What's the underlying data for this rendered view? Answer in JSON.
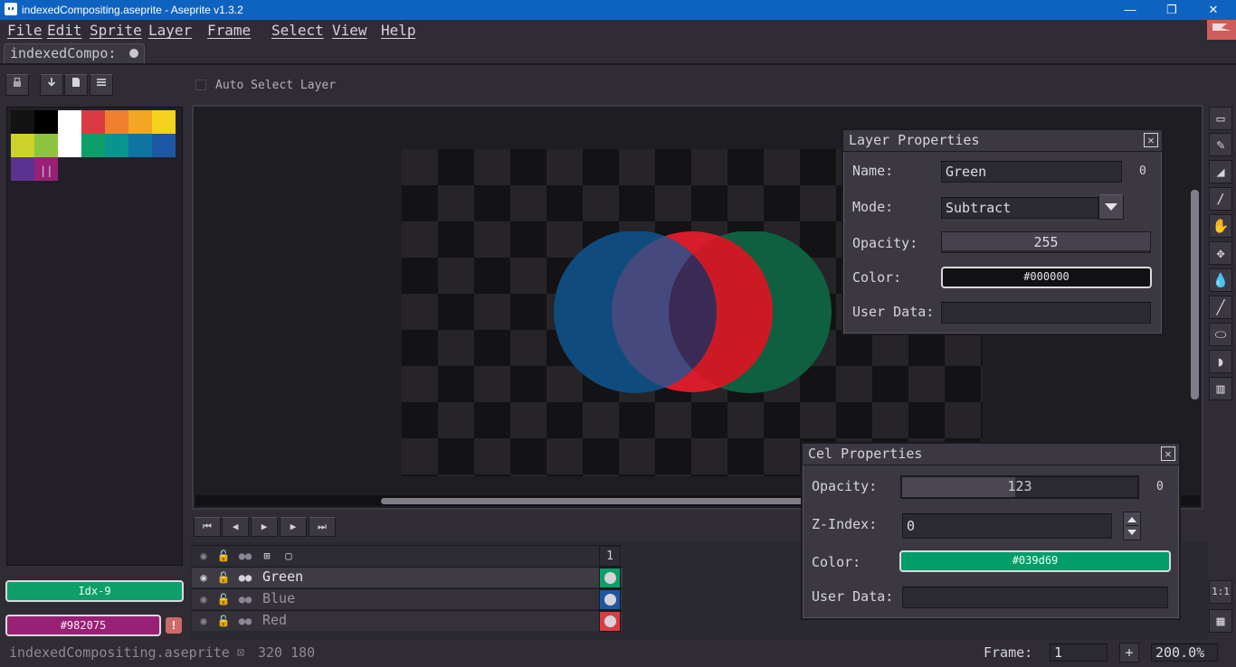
{
  "window": {
    "title": "indexedCompositing.aseprite - Aseprite v1.3.2",
    "minimize_icon": "—",
    "restore_icon": "❐",
    "close_icon": "✕"
  },
  "menu": [
    "File",
    "Edit",
    "Sprite",
    "Layer",
    "Frame",
    "Select",
    "View",
    "Help"
  ],
  "tab": {
    "label": "indexedCompo:"
  },
  "toolbar": {
    "auto_select_label": "Auto Select Layer"
  },
  "palette": {
    "colors": [
      "#121212",
      "#000000",
      "#ffffff",
      "#d93b42",
      "#f07f2f",
      "#f3a623",
      "#f5d21f",
      "#cbd229",
      "#8dc43f",
      "#ffffff",
      "#0d9e69",
      "#09958f",
      "#0f73a3",
      "#1d58a4",
      "#5c3290",
      "#982075"
    ],
    "extra_marker": "||"
  },
  "fg_color": {
    "label": "Idx-9",
    "hex": "#0d9e69"
  },
  "bg_color": {
    "label": "#982075",
    "hex": "#982075"
  },
  "warning_icon": "!",
  "playback": [
    "⏮",
    "◀",
    "▶",
    "▶",
    "⏭"
  ],
  "timeline": {
    "frame_number": "1",
    "layers": [
      {
        "name": "Green",
        "cel_color": "#0d9e69",
        "active": true
      },
      {
        "name": "Blue",
        "cel_color": "#1d58a4",
        "active": false
      },
      {
        "name": "Red",
        "cel_color": "#d93b42",
        "active": false
      }
    ]
  },
  "layer_props": {
    "title": "Layer Properties",
    "close": "✕",
    "name_label": "Name:",
    "name_value": "Green",
    "zero": "0",
    "mode_label": "Mode:",
    "mode_value": "Subtract",
    "opacity_label": "Opacity:",
    "opacity_value": "255",
    "color_label": "Color:",
    "color_value": "#000000",
    "user_data_label": "User Data:"
  },
  "cel_props": {
    "title": "Cel Properties",
    "close": "✕",
    "opacity_label": "Opacity:",
    "opacity_value": "123",
    "opacity_fill": 0.48,
    "zero": "0",
    "zindex_label": "Z-Index:",
    "zindex_value": "0",
    "color_label": "Color:",
    "color_value": "#039d69",
    "color_hex": "#039d69",
    "user_data_label": "User Data:"
  },
  "status": {
    "filename": "indexedCompositing.aseprite",
    "size": "320 180",
    "frame_label": "Frame:",
    "frame_value": "1",
    "plus": "+",
    "zoom": "200.0%"
  },
  "tools": [
    "▭",
    "✎",
    "◢",
    "∕",
    "✋",
    "✥",
    "💧",
    "╱",
    "⬭",
    "◗",
    "▥"
  ],
  "bottom_tools": [
    "1:1",
    "▦"
  ]
}
